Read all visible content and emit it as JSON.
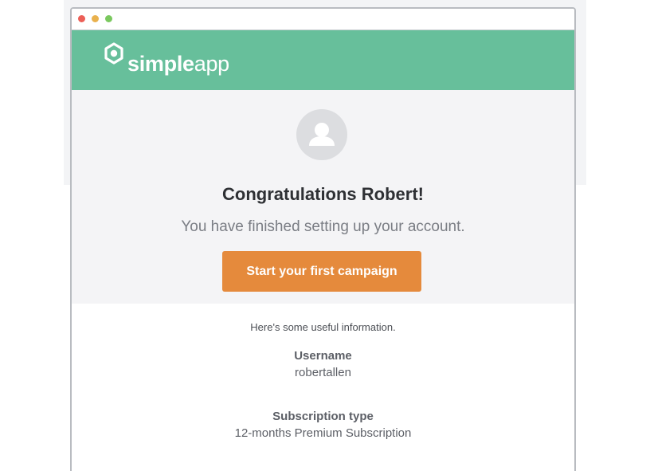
{
  "window": {
    "controls": [
      "close",
      "minimize",
      "maximize"
    ]
  },
  "brand": {
    "name_bold": "simple",
    "name_light": "app",
    "color": "#67bf9b",
    "icon": "hexagon-logo-icon"
  },
  "hero": {
    "avatar_icon": "user-avatar-icon",
    "greeting": "Congratulations Robert!",
    "subtext": "You have finished setting up your account.",
    "cta_label": "Start your first campaign",
    "cta_color": "#e58a3c"
  },
  "info": {
    "intro": "Here's some useful information.",
    "username_label": "Username",
    "username_value": "robertallen",
    "subscription_label": "Subscription type",
    "subscription_value": "12-months Premium Subscription"
  }
}
